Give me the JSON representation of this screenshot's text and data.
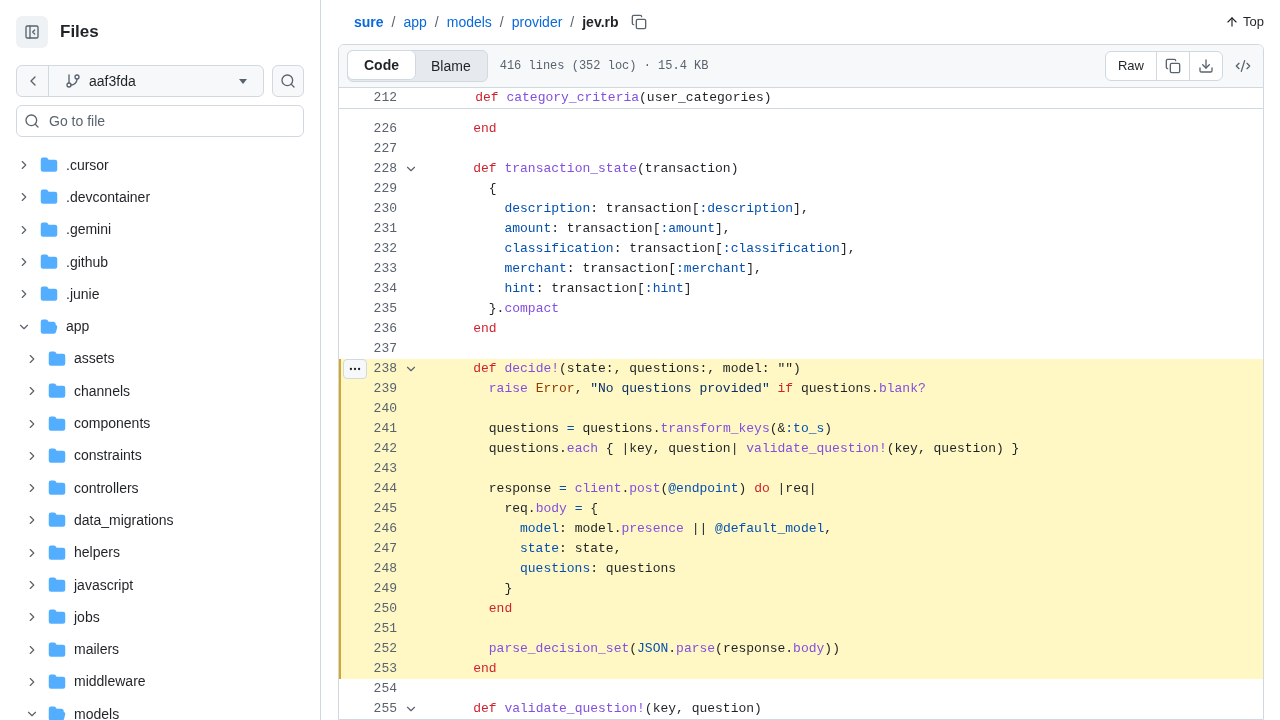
{
  "sidebar": {
    "title": "Files",
    "branch": "aaf3fda",
    "search": {
      "placeholder": "Go to file"
    },
    "tree": [
      {
        "name": ".cursor",
        "expanded": false
      },
      {
        "name": ".devcontainer",
        "expanded": false
      },
      {
        "name": ".gemini",
        "expanded": false
      },
      {
        "name": ".github",
        "expanded": false
      },
      {
        "name": ".junie",
        "expanded": false
      },
      {
        "name": "app",
        "expanded": true,
        "children": [
          {
            "name": "assets",
            "expanded": false
          },
          {
            "name": "channels",
            "expanded": false
          },
          {
            "name": "components",
            "expanded": false
          },
          {
            "name": "constraints",
            "expanded": false
          },
          {
            "name": "controllers",
            "expanded": false
          },
          {
            "name": "data_migrations",
            "expanded": false
          },
          {
            "name": "helpers",
            "expanded": false
          },
          {
            "name": "javascript",
            "expanded": false
          },
          {
            "name": "jobs",
            "expanded": false
          },
          {
            "name": "mailers",
            "expanded": false
          },
          {
            "name": "middleware",
            "expanded": false
          },
          {
            "name": "models",
            "expanded": true
          }
        ]
      }
    ]
  },
  "breadcrumb": [
    {
      "label": "sure",
      "separator": "/"
    },
    {
      "label": "app",
      "separator": "/"
    },
    {
      "label": "models",
      "separator": "/"
    },
    {
      "label": "provider",
      "separator": "/"
    }
  ],
  "file_name": "jev.rb",
  "top_button": "Top",
  "tabs": [
    {
      "label": "Code",
      "selected": true
    },
    {
      "label": "Blame",
      "selected": false
    }
  ],
  "file_info": "416 lines (352 loc) · 15.4 KB",
  "raw_button": "Raw",
  "sticky_line": {
    "number": "212",
    "tokens": [
      {
        "kind": "k",
        "text": "    def "
      },
      {
        "kind": "f",
        "text": "category_criteria"
      },
      {
        "kind": "t",
        "text": "(user_categories)"
      }
    ]
  },
  "lines": [
    {
      "number": "226",
      "fold": false,
      "highlighted": false,
      "tokens": [
        {
          "kind": "k",
          "text": "    end"
        }
      ]
    },
    {
      "number": "227",
      "fold": false,
      "highlighted": false
    },
    {
      "number": "228",
      "fold": true,
      "highlighted": false,
      "tokens": [
        {
          "kind": "k",
          "text": "    def "
        },
        {
          "kind": "f",
          "text": "transaction_state"
        },
        {
          "kind": "t",
          "text": "(transaction)"
        }
      ]
    },
    {
      "number": "229",
      "fold": false,
      "highlighted": false,
      "tokens": [
        {
          "kind": "t",
          "text": "      {"
        }
      ]
    },
    {
      "number": "230",
      "fold": false,
      "highlighted": false,
      "tokens": [
        {
          "kind": "s",
          "text": "        description"
        },
        {
          "kind": "t",
          "text": ": transaction["
        },
        {
          "kind": "s",
          "text": ":description"
        },
        {
          "kind": "t",
          "text": "],"
        }
      ]
    },
    {
      "number": "231",
      "fold": false,
      "highlighted": false,
      "tokens": [
        {
          "kind": "s",
          "text": "        amount"
        },
        {
          "kind": "t",
          "text": ": transaction["
        },
        {
          "kind": "s",
          "text": ":amount"
        },
        {
          "kind": "t",
          "text": "],"
        }
      ]
    },
    {
      "number": "232",
      "fold": false,
      "highlighted": false,
      "tokens": [
        {
          "kind": "s",
          "text": "        classification"
        },
        {
          "kind": "t",
          "text": ": transaction["
        },
        {
          "kind": "s",
          "text": ":classification"
        },
        {
          "kind": "t",
          "text": "],"
        }
      ]
    },
    {
      "number": "233",
      "fold": false,
      "highlighted": false,
      "tokens": [
        {
          "kind": "s",
          "text": "        merchant"
        },
        {
          "kind": "t",
          "text": ": transaction["
        },
        {
          "kind": "s",
          "text": ":merchant"
        },
        {
          "kind": "t",
          "text": "],"
        }
      ]
    },
    {
      "number": "234",
      "fold": false,
      "highlighted": false,
      "tokens": [
        {
          "kind": "s",
          "text": "        hint"
        },
        {
          "kind": "t",
          "text": ": transaction["
        },
        {
          "kind": "s",
          "text": ":hint"
        },
        {
          "kind": "t",
          "text": "]"
        }
      ]
    },
    {
      "number": "235",
      "fold": false,
      "highlighted": false,
      "tokens": [
        {
          "kind": "t",
          "text": "      }."
        },
        {
          "kind": "f",
          "text": "compact"
        }
      ]
    },
    {
      "number": "236",
      "fold": false,
      "highlighted": false,
      "tokens": [
        {
          "kind": "k",
          "text": "    end"
        }
      ]
    },
    {
      "number": "237",
      "fold": false,
      "highlighted": false
    },
    {
      "number": "238",
      "fold": true,
      "highlighted": true,
      "tokens": [
        {
          "kind": "k",
          "text": "    def "
        },
        {
          "kind": "f",
          "text": "decide!"
        },
        {
          "kind": "t",
          "text": "(state:, questions:, model: \"\")"
        }
      ]
    },
    {
      "number": "239",
      "fold": false,
      "highlighted": true,
      "tokens": [
        {
          "kind": "f",
          "text": "      raise "
        },
        {
          "kind": "c",
          "text": "Error"
        },
        {
          "kind": "t",
          "text": ", "
        },
        {
          "kind": "q",
          "text": "\"No questions provided\""
        },
        {
          "kind": "k",
          "text": " if "
        },
        {
          "kind": "t",
          "text": "questions."
        },
        {
          "kind": "f",
          "text": "blank?"
        }
      ]
    },
    {
      "number": "240",
      "fold": false,
      "highlighted": true
    },
    {
      "number": "241",
      "fold": false,
      "highlighted": true,
      "tokens": [
        {
          "kind": "t",
          "text": "      questions "
        },
        {
          "kind": "s",
          "text": "="
        },
        {
          "kind": "t",
          "text": " questions."
        },
        {
          "kind": "f",
          "text": "transform_keys"
        },
        {
          "kind": "t",
          "text": "(&"
        },
        {
          "kind": "s",
          "text": ":to_s"
        },
        {
          "kind": "t",
          "text": ")"
        }
      ]
    },
    {
      "number": "242",
      "fold": false,
      "highlighted": true,
      "tokens": [
        {
          "kind": "t",
          "text": "      questions."
        },
        {
          "kind": "f",
          "text": "each"
        },
        {
          "kind": "t",
          "text": " { |key, question| "
        },
        {
          "kind": "f",
          "text": "validate_question!"
        },
        {
          "kind": "t",
          "text": "(key, question) }"
        }
      ]
    },
    {
      "number": "243",
      "fold": false,
      "highlighted": true
    },
    {
      "number": "244",
      "fold": false,
      "highlighted": true,
      "tokens": [
        {
          "kind": "t",
          "text": "      response "
        },
        {
          "kind": "s",
          "text": "="
        },
        {
          "kind": "f",
          "text": " client"
        },
        {
          "kind": "t",
          "text": "."
        },
        {
          "kind": "f",
          "text": "post"
        },
        {
          "kind": "t",
          "text": "("
        },
        {
          "kind": "s",
          "text": "@endpoint"
        },
        {
          "kind": "t",
          "text": ") "
        },
        {
          "kind": "k",
          "text": "do"
        },
        {
          "kind": "t",
          "text": " |req|"
        }
      ]
    },
    {
      "number": "245",
      "fold": false,
      "highlighted": true,
      "tokens": [
        {
          "kind": "t",
          "text": "        req."
        },
        {
          "kind": "f",
          "text": "body"
        },
        {
          "kind": "s",
          "text": " ="
        },
        {
          "kind": "t",
          "text": " {"
        }
      ]
    },
    {
      "number": "246",
      "fold": false,
      "highlighted": true,
      "tokens": [
        {
          "kind": "s",
          "text": "          model"
        },
        {
          "kind": "t",
          "text": ": model."
        },
        {
          "kind": "f",
          "text": "presence"
        },
        {
          "kind": "t",
          "text": " || "
        },
        {
          "kind": "s",
          "text": "@default_model"
        },
        {
          "kind": "t",
          "text": ","
        }
      ]
    },
    {
      "number": "247",
      "fold": false,
      "highlighted": true,
      "tokens": [
        {
          "kind": "s",
          "text": "          state"
        },
        {
          "kind": "t",
          "text": ": state,"
        }
      ]
    },
    {
      "number": "248",
      "fold": false,
      "highlighted": true,
      "tokens": [
        {
          "kind": "s",
          "text": "          questions"
        },
        {
          "kind": "t",
          "text": ": questions"
        }
      ]
    },
    {
      "number": "249",
      "fold": false,
      "highlighted": true,
      "tokens": [
        {
          "kind": "t",
          "text": "        }"
        }
      ]
    },
    {
      "number": "250",
      "fold": false,
      "highlighted": true,
      "tokens": [
        {
          "kind": "k",
          "text": "      end"
        }
      ]
    },
    {
      "number": "251",
      "fold": false,
      "highlighted": true
    },
    {
      "number": "252",
      "fold": false,
      "highlighted": true,
      "tokens": [
        {
          "kind": "f",
          "text": "      parse_decision_set"
        },
        {
          "kind": "t",
          "text": "("
        },
        {
          "kind": "s",
          "text": "JSON"
        },
        {
          "kind": "t",
          "text": "."
        },
        {
          "kind": "f",
          "text": "parse"
        },
        {
          "kind": "t",
          "text": "(response."
        },
        {
          "kind": "f",
          "text": "body"
        },
        {
          "kind": "t",
          "text": "))"
        }
      ]
    },
    {
      "number": "253",
      "fold": false,
      "highlighted": true,
      "tokens": [
        {
          "kind": "k",
          "text": "    end"
        }
      ]
    },
    {
      "number": "254",
      "fold": false,
      "highlighted": false
    },
    {
      "number": "255",
      "fold": true,
      "highlighted": false,
      "tokens": [
        {
          "kind": "k",
          "text": "    def "
        },
        {
          "kind": "f",
          "text": "validate_question!"
        },
        {
          "kind": "t",
          "text": "(key, question)"
        }
      ]
    }
  ]
}
